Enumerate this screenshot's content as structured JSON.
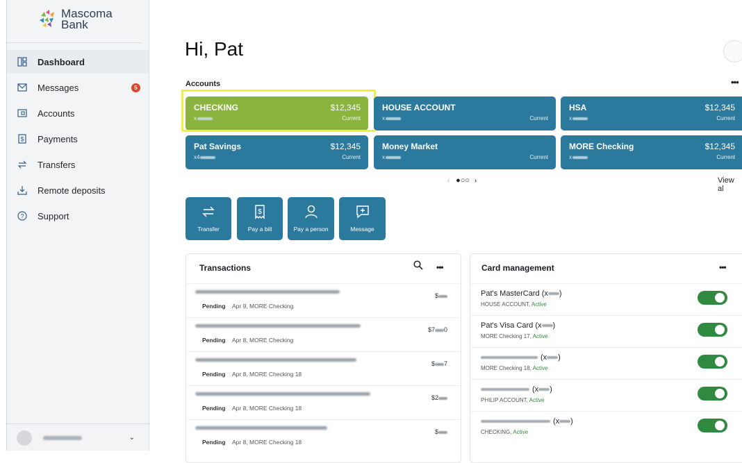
{
  "brand": {
    "name_line1": "Mascoma",
    "name_line2": "Bank"
  },
  "sidebar": {
    "items": [
      {
        "label": "Dashboard",
        "icon": "dashboard-icon",
        "active": true
      },
      {
        "label": "Messages",
        "icon": "envelope-icon",
        "badge": "5"
      },
      {
        "label": "Accounts",
        "icon": "accounts-icon"
      },
      {
        "label": "Payments",
        "icon": "dollar-document-icon"
      },
      {
        "label": "Transfers",
        "icon": "transfer-arrows-icon"
      },
      {
        "label": "Remote deposits",
        "icon": "download-tray-icon"
      },
      {
        "label": "Support",
        "icon": "help-circle-icon"
      }
    ]
  },
  "header": {
    "greeting": "Hi, Pat"
  },
  "accounts": {
    "label": "Accounts",
    "view_all": "View al",
    "cards": [
      {
        "name": "CHECKING",
        "num_prefix": "x",
        "balance": "$12,345",
        "status": "Current",
        "highlighted": true
      },
      {
        "name": "HOUSE ACCOUNT",
        "num_prefix": "x",
        "balance": "",
        "status": "Current"
      },
      {
        "name": "HSA",
        "num_prefix": "x",
        "balance": "$12,345",
        "status": "Current"
      },
      {
        "name": "Pat Savings",
        "num_prefix": "x4",
        "balance": "$12,345",
        "status": "Current"
      },
      {
        "name": "Money Market",
        "num_prefix": "x",
        "balance": "",
        "status": "Current"
      },
      {
        "name": "MORE Checking",
        "num_prefix": "x",
        "balance": "$12,345",
        "status": "Current"
      }
    ],
    "pager": {
      "prev": "‹",
      "dots": "●○○",
      "next": "›"
    }
  },
  "quick_actions": [
    {
      "label": "Transfer",
      "icon": "transfer-icon"
    },
    {
      "label": "Pay a bill",
      "icon": "bill-icon"
    },
    {
      "label": "Pay a person",
      "icon": "person-icon"
    },
    {
      "label": "Message",
      "icon": "message-icon"
    }
  ],
  "transactions": {
    "title": "Transactions",
    "rows": [
      {
        "status": "Pending",
        "meta": "Apr 9, MORE Checking",
        "amount_prefix": "$",
        "amount_suffix": ""
      },
      {
        "status": "Pending",
        "meta": "Apr 8, MORE Checking",
        "amount_prefix": "$7",
        "amount_suffix": "0"
      },
      {
        "status": "Pending",
        "meta": "Apr 8, MORE Checking 18",
        "amount_prefix": "$",
        "amount_suffix": "7"
      },
      {
        "status": "Pending",
        "meta": "Apr 8, MORE Checking 18",
        "amount_prefix": "$2",
        "amount_suffix": ""
      },
      {
        "status": "Pending",
        "meta": "Apr 8, MORE Checking 18",
        "amount_prefix": "$",
        "amount_suffix": ""
      }
    ]
  },
  "card_management": {
    "title": "Card management",
    "cards": [
      {
        "name": "Pat's MasterCard",
        "num_open": "(x",
        "num_close": ")",
        "owner": "HOUSE ACCOUNT,",
        "state": "Active"
      },
      {
        "name": "Pat's Visa Card",
        "num_open": "(x",
        "num_close": ")",
        "owner": "MORE Checking 17,",
        "state": "Active"
      },
      {
        "name": "",
        "num_open": "(x",
        "num_close": ")",
        "owner": "MORE Checking 18,",
        "state": "Active"
      },
      {
        "name": "",
        "num_open": "(x",
        "num_close": ")",
        "owner": "PHILIP ACCOUNT,",
        "state": "Active"
      },
      {
        "name": "",
        "num_open": "(x",
        "num_close": ")",
        "owner": "CHECKING,",
        "state": "Active"
      }
    ]
  },
  "colors": {
    "teal": "#2b7a9e",
    "checking_green": "#8bb43f",
    "highlight": "#f4ef3e",
    "toggle_on": "#2f8a40",
    "badge": "#d9482b"
  }
}
